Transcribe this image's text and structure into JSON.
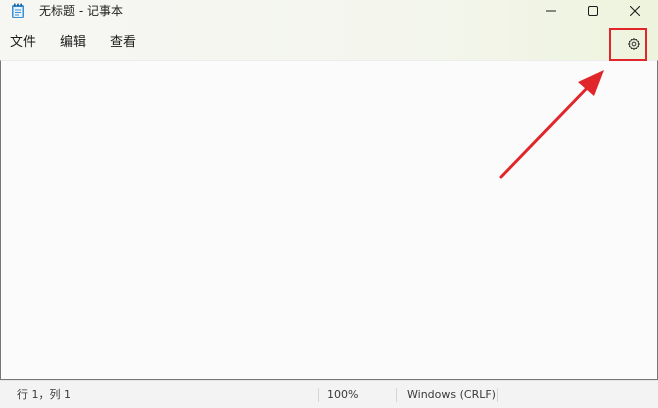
{
  "window": {
    "title": "无标题 - 记事本",
    "app_icon": "notepad-icon",
    "controls": {
      "minimize": "minimize-icon",
      "maximize": "maximize-icon",
      "close": "close-icon"
    }
  },
  "menu": {
    "items": [
      {
        "label": "文件"
      },
      {
        "label": "编辑"
      },
      {
        "label": "查看"
      }
    ],
    "settings_icon": "gear-icon"
  },
  "editor": {
    "content": ""
  },
  "annotation": {
    "color": "#e0262b",
    "target": "settings-button",
    "shapes": [
      "highlight-box",
      "pointer-arrow"
    ]
  },
  "status": {
    "position": "行 1，列 1",
    "zoom": "100%",
    "line_ending": "Windows (CRLF)"
  }
}
